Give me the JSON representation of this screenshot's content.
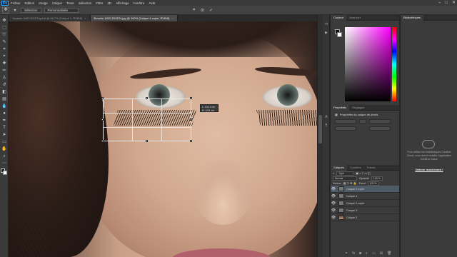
{
  "app": {
    "logo": "Ps"
  },
  "menu": [
    "Fichier",
    "Edition",
    "Image",
    "Calque",
    "Texte",
    "Sélection",
    "Filtre",
    "3D",
    "Affichage",
    "Fenêtre",
    "Aide"
  ],
  "window_controls": [
    "–",
    "□",
    "✕"
  ],
  "options": {
    "tool_icon": "move-icon",
    "field1": "Sélection",
    "field2": "Personnalisée",
    "cancel_icon": "⊘",
    "commit_icon": "✓"
  },
  "tabs": [
    {
      "label": "Youtube HAR 0021Tuyd.tif @ 66,7% (Calque 1, RVB/8)",
      "active": false
    },
    {
      "label": "Bouche 1920 Z8J37H.jpg @ 200% (Calque 4 copie, RVB/8)",
      "active": true
    }
  ],
  "transform_info": {
    "line1": "L: 19,14 cm",
    "line2": "H: 3,81 cm"
  },
  "color_panel": {
    "tabs": [
      "Couleur",
      "Nuancier"
    ]
  },
  "library_panel": {
    "tabs": [
      "Bibliothèques"
    ],
    "message": "Pour utiliser les bibliothèques Creative Cloud, vous devez installer l'application Creative Cloud.",
    "link": "Obtenir maintenant !"
  },
  "properties_panel": {
    "tabs": [
      "Propriétés",
      "Réglages"
    ],
    "title": "Propriétés du calque de pixels"
  },
  "layers_panel": {
    "tabs": [
      "Calques",
      "Couches",
      "Tracés"
    ],
    "filter": "Type",
    "blend_mode": "Normal",
    "opacity_label": "Opacité",
    "opacity": "100 %",
    "lock_label": "Verrou",
    "fill_label": "Fond",
    "fill": "100 %",
    "layers": [
      {
        "name": "Calque 4 copie",
        "selected": true
      },
      {
        "name": "Calque 4",
        "selected": false
      },
      {
        "name": "Calque 3 copie",
        "selected": false
      },
      {
        "name": "Calque 3",
        "selected": false
      },
      {
        "name": "Calque 2",
        "selected": false
      }
    ]
  }
}
